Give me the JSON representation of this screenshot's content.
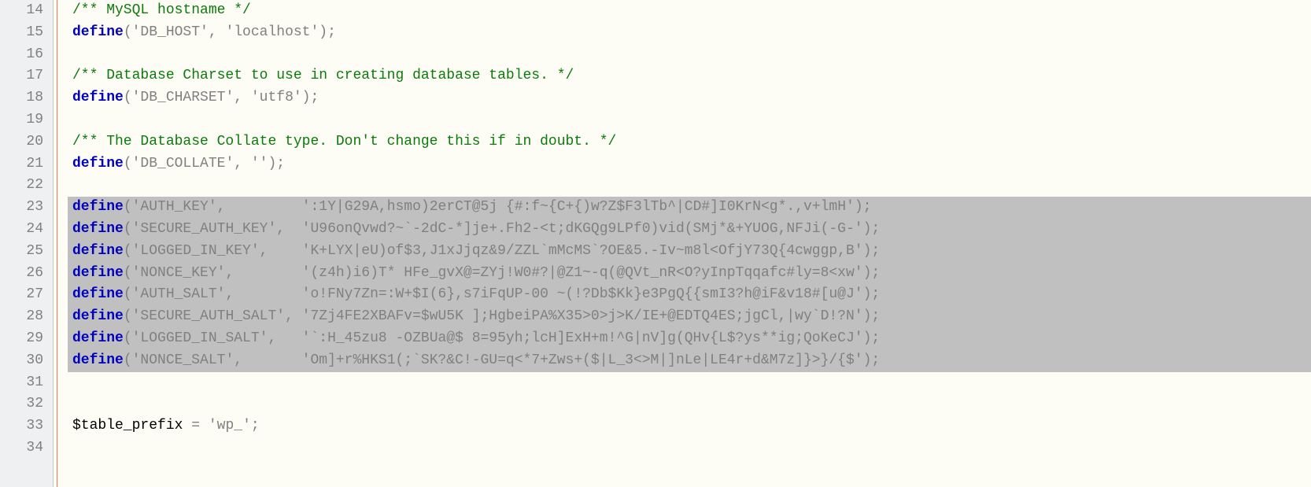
{
  "lineStart": 14,
  "lines": [
    {
      "n": 14,
      "sel": false,
      "tokens": [
        {
          "c": "tok-comment",
          "t": "/** MySQL hostname */"
        }
      ]
    },
    {
      "n": 15,
      "sel": false,
      "tokens": [
        {
          "c": "tok-keyword",
          "t": "define"
        },
        {
          "c": "tok-paren",
          "t": "("
        },
        {
          "c": "tok-str",
          "t": "'DB_HOST'"
        },
        {
          "c": "tok-paren",
          "t": ", "
        },
        {
          "c": "tok-str",
          "t": "'localhost'"
        },
        {
          "c": "tok-paren",
          "t": ")"
        },
        {
          "c": "tok-semi",
          "t": ";"
        }
      ]
    },
    {
      "n": 16,
      "sel": false,
      "tokens": []
    },
    {
      "n": 17,
      "sel": false,
      "tokens": [
        {
          "c": "tok-comment",
          "t": "/** Database Charset to use in creating database tables. */"
        }
      ]
    },
    {
      "n": 18,
      "sel": false,
      "tokens": [
        {
          "c": "tok-keyword",
          "t": "define"
        },
        {
          "c": "tok-paren",
          "t": "("
        },
        {
          "c": "tok-str",
          "t": "'DB_CHARSET'"
        },
        {
          "c": "tok-paren",
          "t": ", "
        },
        {
          "c": "tok-str",
          "t": "'utf8'"
        },
        {
          "c": "tok-paren",
          "t": ")"
        },
        {
          "c": "tok-semi",
          "t": ";"
        }
      ]
    },
    {
      "n": 19,
      "sel": false,
      "tokens": []
    },
    {
      "n": 20,
      "sel": false,
      "tokens": [
        {
          "c": "tok-comment",
          "t": "/** The Database Collate type. Don't change this if in doubt. */"
        }
      ]
    },
    {
      "n": 21,
      "sel": false,
      "tokens": [
        {
          "c": "tok-keyword",
          "t": "define"
        },
        {
          "c": "tok-paren",
          "t": "("
        },
        {
          "c": "tok-str",
          "t": "'DB_COLLATE'"
        },
        {
          "c": "tok-paren",
          "t": ", "
        },
        {
          "c": "tok-str",
          "t": "''"
        },
        {
          "c": "tok-paren",
          "t": ")"
        },
        {
          "c": "tok-semi",
          "t": ";"
        }
      ]
    },
    {
      "n": 22,
      "sel": false,
      "tokens": []
    },
    {
      "n": 23,
      "sel": true,
      "tokens": [
        {
          "c": "tok-keyword",
          "t": "define"
        },
        {
          "c": "tok-paren",
          "t": "("
        },
        {
          "c": "tok-str",
          "t": "'AUTH_KEY'"
        },
        {
          "c": "tok-paren",
          "t": ",         "
        },
        {
          "c": "tok-str",
          "t": "':1Y|G29A,hsmo)2erCT@5j {#:f~{C+{)w?Z$F3lTb^|CD#]I0KrN<g*.,v+lmH'"
        },
        {
          "c": "tok-paren",
          "t": ")"
        },
        {
          "c": "tok-semi",
          "t": ";"
        }
      ]
    },
    {
      "n": 24,
      "sel": true,
      "tokens": [
        {
          "c": "tok-keyword",
          "t": "define"
        },
        {
          "c": "tok-paren",
          "t": "("
        },
        {
          "c": "tok-str",
          "t": "'SECURE_AUTH_KEY'"
        },
        {
          "c": "tok-paren",
          "t": ",  "
        },
        {
          "c": "tok-str",
          "t": "'U96onQvwd?~`-2dC-*]je+.Fh2-<t;dKGQg9LPf0)vid(SMj*&+YUOG,NFJi(-G-'"
        },
        {
          "c": "tok-paren",
          "t": ")"
        },
        {
          "c": "tok-semi",
          "t": ";"
        }
      ]
    },
    {
      "n": 25,
      "sel": true,
      "tokens": [
        {
          "c": "tok-keyword",
          "t": "define"
        },
        {
          "c": "tok-paren",
          "t": "("
        },
        {
          "c": "tok-str",
          "t": "'LOGGED_IN_KEY'"
        },
        {
          "c": "tok-paren",
          "t": ",    "
        },
        {
          "c": "tok-str",
          "t": "'K+LYX|eU)of$3,J1xJjqz&9/ZZL`mMcMS`?OE&5.-Iv~m8l<OfjY73Q{4cwggp,B'"
        },
        {
          "c": "tok-paren",
          "t": ")"
        },
        {
          "c": "tok-semi",
          "t": ";"
        }
      ]
    },
    {
      "n": 26,
      "sel": true,
      "tokens": [
        {
          "c": "tok-keyword",
          "t": "define"
        },
        {
          "c": "tok-paren",
          "t": "("
        },
        {
          "c": "tok-str",
          "t": "'NONCE_KEY'"
        },
        {
          "c": "tok-paren",
          "t": ",        "
        },
        {
          "c": "tok-str",
          "t": "'(z4h)i6)T* HFe_gvX@=ZYj!W0#?|@Z1~-q(@QVt_nR<O?yInpTqqafc#ly=8<xw'"
        },
        {
          "c": "tok-paren",
          "t": ")"
        },
        {
          "c": "tok-semi",
          "t": ";"
        }
      ]
    },
    {
      "n": 27,
      "sel": true,
      "tokens": [
        {
          "c": "tok-keyword",
          "t": "define"
        },
        {
          "c": "tok-paren",
          "t": "("
        },
        {
          "c": "tok-str",
          "t": "'AUTH_SALT'"
        },
        {
          "c": "tok-paren",
          "t": ",        "
        },
        {
          "c": "tok-str",
          "t": "'o!FNy7Zn=:W+$I(6},s7iFqUP-00 ~(!?Db$Kk}e3PgQ{{smI3?h@iF&v18#[u@J'"
        },
        {
          "c": "tok-paren",
          "t": ")"
        },
        {
          "c": "tok-semi",
          "t": ";"
        }
      ]
    },
    {
      "n": 28,
      "sel": true,
      "tokens": [
        {
          "c": "tok-keyword",
          "t": "define"
        },
        {
          "c": "tok-paren",
          "t": "("
        },
        {
          "c": "tok-str",
          "t": "'SECURE_AUTH_SALT'"
        },
        {
          "c": "tok-paren",
          "t": ", "
        },
        {
          "c": "tok-str",
          "t": "'7Zj4FE2XBAFv=$wU5K ];HgbeiPA%X35>0>j>K/IE+@EDTQ4ES;jgCl,|wy`D!?N'"
        },
        {
          "c": "tok-paren",
          "t": ")"
        },
        {
          "c": "tok-semi",
          "t": ";"
        }
      ]
    },
    {
      "n": 29,
      "sel": true,
      "tokens": [
        {
          "c": "tok-keyword",
          "t": "define"
        },
        {
          "c": "tok-paren",
          "t": "("
        },
        {
          "c": "tok-str",
          "t": "'LOGGED_IN_SALT'"
        },
        {
          "c": "tok-paren",
          "t": ",   "
        },
        {
          "c": "tok-str",
          "t": "'`:H_45zu8 -OZBUa@$ 8=95yh;lcH]ExH+m!^G|nV]g(QHv{L$?ys**ig;QoKeCJ'"
        },
        {
          "c": "tok-paren",
          "t": ")"
        },
        {
          "c": "tok-semi",
          "t": ";"
        }
      ]
    },
    {
      "n": 30,
      "sel": true,
      "tokens": [
        {
          "c": "tok-keyword",
          "t": "define"
        },
        {
          "c": "tok-paren",
          "t": "("
        },
        {
          "c": "tok-str",
          "t": "'NONCE_SALT'"
        },
        {
          "c": "tok-paren",
          "t": ",       "
        },
        {
          "c": "tok-str",
          "t": "'Om]+r%HKS1(;`SK?&C!-GU=q<*7+Zws+($|L_3<>M|]nLe|LE4r+d&M7z]}>}/{$'"
        },
        {
          "c": "tok-paren",
          "t": ")"
        },
        {
          "c": "tok-semi",
          "t": ";"
        }
      ]
    },
    {
      "n": 31,
      "sel": false,
      "tokens": []
    },
    {
      "n": 32,
      "sel": false,
      "tokens": []
    },
    {
      "n": 33,
      "sel": false,
      "tokens": [
        {
          "c": "tok-var",
          "t": "$table_prefix"
        },
        {
          "c": "tok-plain",
          "t": " "
        },
        {
          "c": "tok-op",
          "t": "="
        },
        {
          "c": "tok-plain",
          "t": " "
        },
        {
          "c": "tok-str",
          "t": "'wp_'"
        },
        {
          "c": "tok-semi",
          "t": ";"
        }
      ]
    },
    {
      "n": 34,
      "sel": false,
      "tokens": []
    }
  ]
}
